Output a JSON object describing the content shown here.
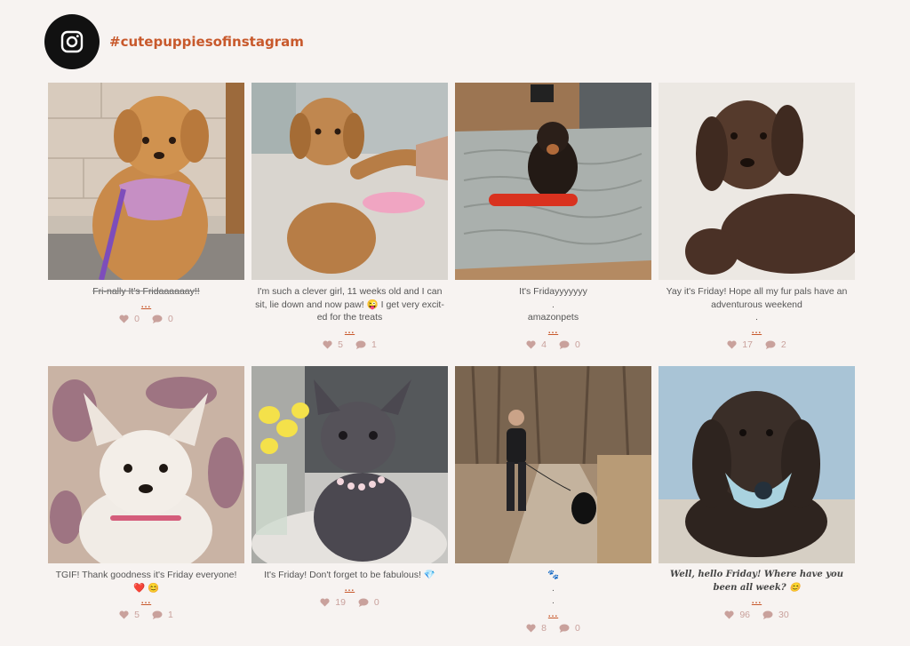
{
  "header": {
    "icon": "instagram-icon",
    "hashtag": "#cutepuppiesofinstagram",
    "colors": {
      "accent": "#c8592c",
      "badge": "#111111",
      "stat": "#c9a19c",
      "background": "#f7f3f1"
    }
  },
  "more_label": "...",
  "posts": [
    {
      "caption": "Fri-nally It's Fridaaaaaay!!",
      "likes": "0",
      "comments": "0",
      "photo": "golden-doodle-puppy-purple-harness"
    },
    {
      "caption": "I'm such a clever girl, 11 weeks old and I can sit, lie down and now paw! 😜 I get very excit-ed for the treats",
      "likes": "5",
      "comments": "1",
      "photo": "cockapoo-puppy-giving-paw"
    },
    {
      "caption": "It's Fridayyyyyyy\n.\namazonpets",
      "likes": "4",
      "comments": "0",
      "photo": "dachshund-puppy-on-blanket"
    },
    {
      "caption": "Yay it's Friday! Hope all my fur pals have an adventurous weekend\n.",
      "likes": "17",
      "comments": "2",
      "photo": "brown-spaniel-puppy"
    },
    {
      "caption": "TGIF! Thank goodness it's Friday everyone! ❤️ 😊",
      "likes": "5",
      "comments": "1",
      "photo": "white-chihuahua"
    },
    {
      "caption": "It's Friday! Don't forget to be fabulous! 💎",
      "likes": "19",
      "comments": "0",
      "photo": "french-bulldog-with-flowers"
    },
    {
      "caption": "🐾\n.\n.",
      "likes": "8",
      "comments": "0",
      "photo": "man-walking-dog-on-path"
    },
    {
      "caption": "Well, hello Friday! Where have you been all week? 😊",
      "likes": "96",
      "comments": "30",
      "photo": "black-cockapoo-blue-bandana"
    }
  ]
}
